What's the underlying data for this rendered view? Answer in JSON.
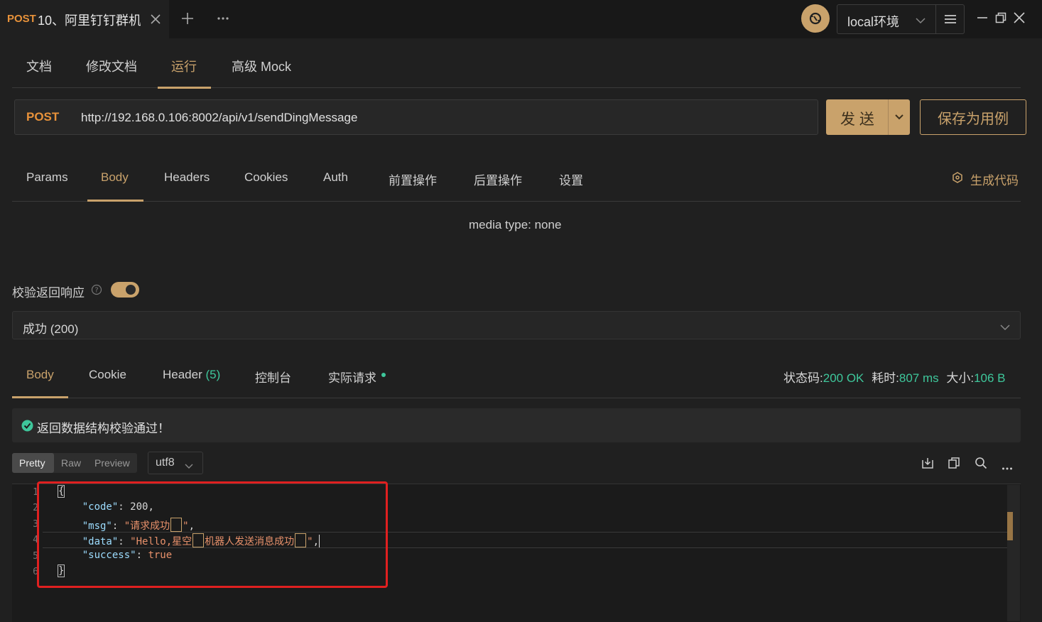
{
  "tab": {
    "method": "POST",
    "title": "10、阿里钉钉群机器人"
  },
  "env": {
    "name": "local环境"
  },
  "doc_tabs": [
    "文档",
    "修改文档",
    "运行",
    "高级 Mock"
  ],
  "request": {
    "method": "POST",
    "url": "http://192.168.0.106:8002/api/v1/sendDingMessage",
    "send_label": "发 送",
    "save_label": "保存为用例"
  },
  "req_tabs": [
    "Params",
    "Body",
    "Headers",
    "Cookies",
    "Auth",
    "前置操作",
    "后置操作",
    "设置"
  ],
  "generate_code": "生成代码",
  "media_type": "media type: none",
  "validate": {
    "label": "校验返回响应",
    "enabled": true,
    "selected": "成功 (200)"
  },
  "resp_tabs": {
    "body": "Body",
    "cookie": "Cookie",
    "header": "Header",
    "header_count": "(5)",
    "console": "控制台",
    "actual": "实际请求"
  },
  "status": {
    "status_label": "状态码:",
    "status_value": "200 OK",
    "time_label": "耗时:",
    "time_value": "807 ms",
    "size_label": "大小:",
    "size_value": "106 B"
  },
  "validation_msg": "返回数据结构校验通过！",
  "view_modes": [
    "Pretty",
    "Raw",
    "Preview"
  ],
  "encoding": "utf8",
  "line_numbers": [
    "1",
    "2",
    "3",
    "4",
    "5",
    "6"
  ],
  "code": {
    "open": "{",
    "code_key": "\"code\"",
    "code_val": "200",
    "msg_key": "\"msg\"",
    "msg_val_a": "\"请求成功",
    "msg_val_b": "\"",
    "data_key": "\"data\"",
    "data_val_a": "\"Hello,星空",
    "data_val_b": "机器人发送消息成功",
    "data_val_c": "\"",
    "success_key": "\"success\"",
    "success_val": "true",
    "close": "}"
  },
  "colors": {
    "accent": "#c9a26b",
    "success": "#3ec79b",
    "method": "#e8923a",
    "highlight_box": "#e02020"
  }
}
